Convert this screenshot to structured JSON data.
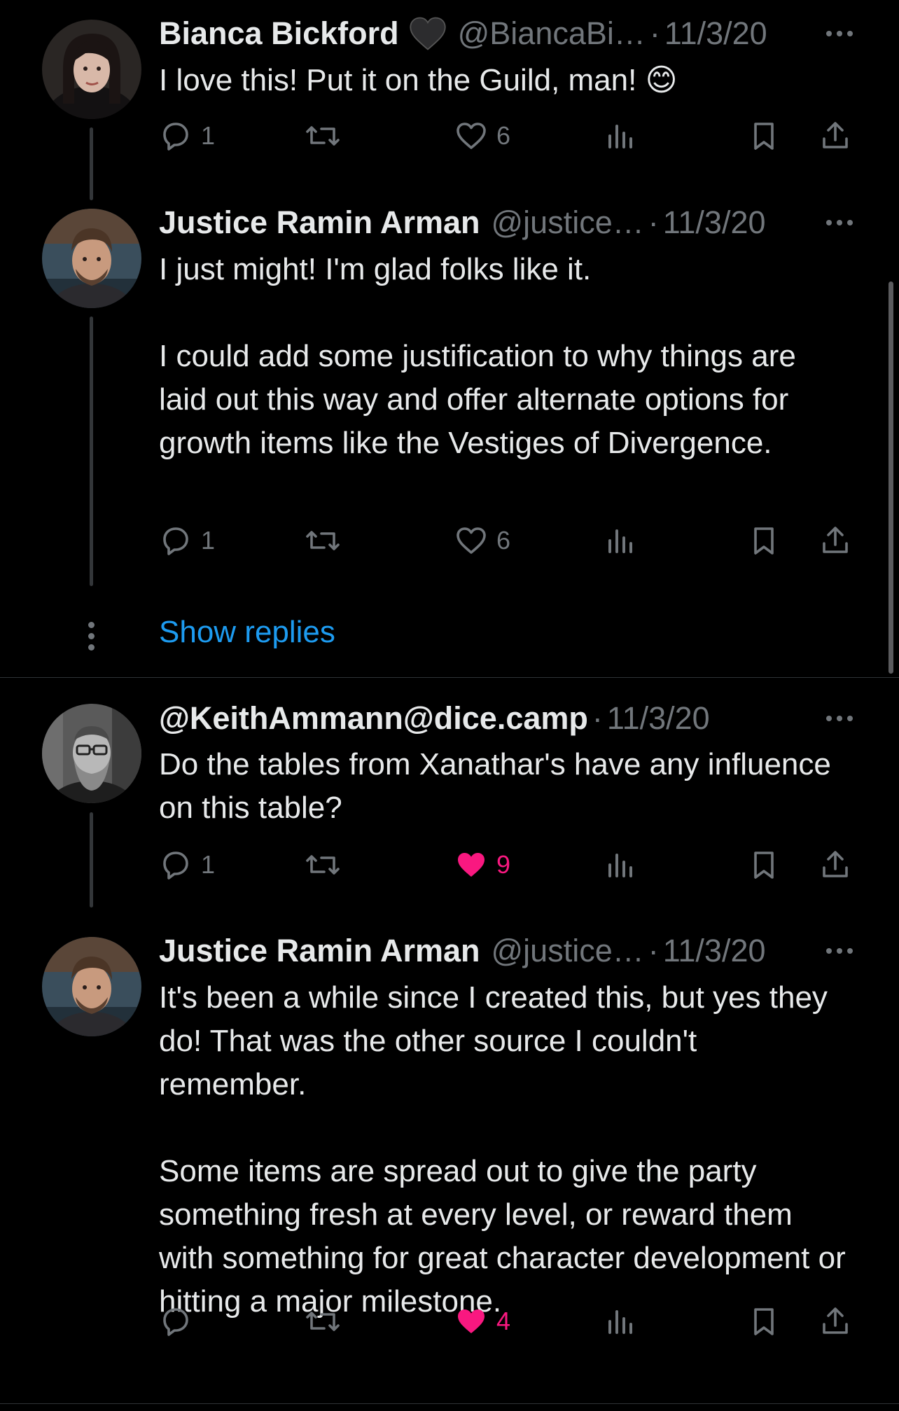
{
  "tweets": [
    {
      "name": "Bianca Bickford",
      "name_emoji": "black-heart",
      "handle": "@BiancaBi…",
      "date": "11/3/20",
      "text": "I love this! Put it on the Guild, man! 😊",
      "replies": "1",
      "retweets": "",
      "likes": "6",
      "liked": false
    },
    {
      "name": "Justice Ramin Arman",
      "handle": "@justice…",
      "date": "11/3/20",
      "text": "I just might! I'm glad folks like it.\n\nI could add some justification to why things are laid out this way and offer alternate options for growth items like the Vestiges of Divergence.",
      "replies": "1",
      "retweets": "",
      "likes": "6",
      "liked": false
    },
    {
      "name": "@KeithAmmann@dice.camp",
      "handle": "",
      "date": "11/3/20",
      "text": "Do the tables from Xanathar's have any influence on this table?",
      "replies": "1",
      "retweets": "",
      "likes": "9",
      "liked": true
    },
    {
      "name": "Justice Ramin Arman",
      "handle": "@justice…",
      "date": "11/3/20",
      "text": "It's been a while since I created this, but yes they do! That was the other source I couldn't remember.\n\nSome items are spread out to give the party something fresh at every level, or reward them with something for great character development or hitting a major milestone.",
      "replies": "",
      "retweets": "",
      "likes": "4",
      "liked": true
    }
  ],
  "show_replies_label": "Show replies",
  "dot_separator": "·",
  "colors": {
    "background": "#000000",
    "text": "#e7e9ea",
    "muted": "#71767b",
    "link": "#1d9bf0",
    "like": "#f91880"
  }
}
